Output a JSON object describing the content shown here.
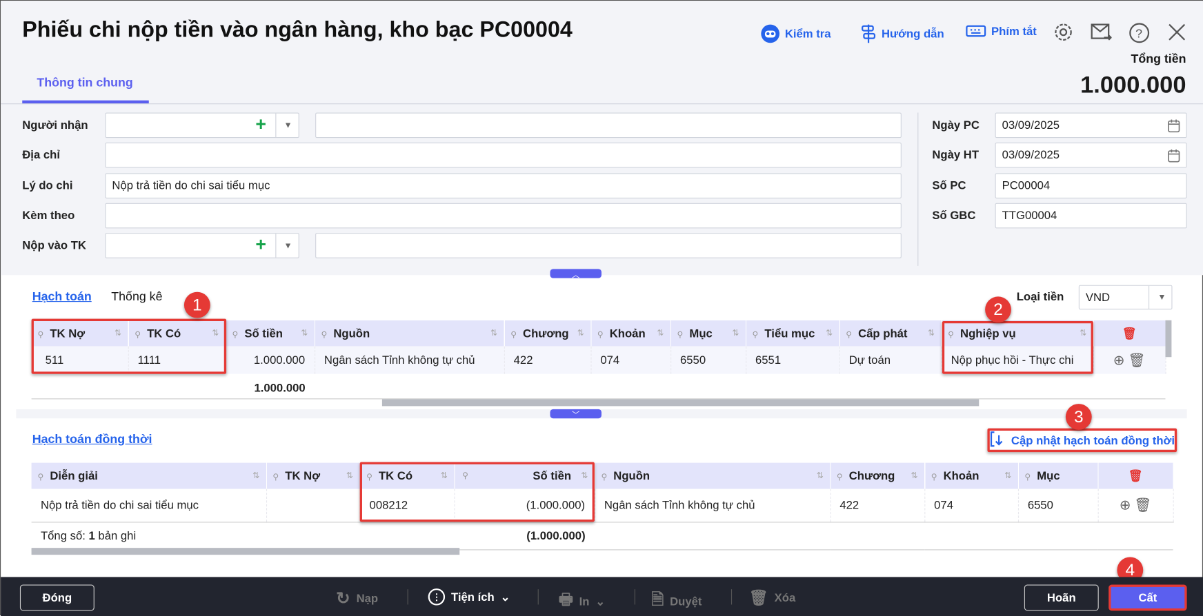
{
  "header": {
    "title": "Phiếu chi nộp tiền vào ngân hàng, kho bạc PC00004",
    "tools": {
      "check": "Kiểm tra",
      "guide": "Hướng dẫn",
      "shortcut": "Phím tắt"
    },
    "total_label": "Tổng tiền",
    "total_value": "1.000.000",
    "tab": "Thông tin chung"
  },
  "form": {
    "recipient_label": "Người nhận",
    "recipient_value": "",
    "recipient_name": "",
    "address_label": "Địa chỉ",
    "address_value": "",
    "reason_label": "Lý do chi",
    "reason_value": "Nộp trả tiền do chi sai tiểu mục",
    "attach_label": "Kèm theo",
    "attach_value": "",
    "account_label": "Nộp vào TK",
    "account_value": "",
    "account_name": "",
    "date_pc_label": "Ngày PC",
    "date_pc": "03/09/2025",
    "date_ht_label": "Ngày HT",
    "date_ht": "03/09/2025",
    "so_pc_label": "Số PC",
    "so_pc": "PC00004",
    "so_gbc_label": "Số GBC",
    "so_gbc": "TTG00004"
  },
  "section1": {
    "tabs": [
      "Hạch toán",
      "Thống kê"
    ],
    "currency_label": "Loại tiền",
    "currency": "VND",
    "columns": [
      "TK Nợ",
      "TK Có",
      "Số tiền",
      "Nguồn",
      "Chương",
      "Khoản",
      "Mục",
      "Tiểu mục",
      "Cấp phát",
      "Nghiệp vụ"
    ],
    "rows": [
      [
        "511",
        "1111",
        "1.000.000",
        "Ngân sách Tỉnh không tự chủ",
        "422",
        "074",
        "6550",
        "6551",
        "Dự toán",
        "Nộp phục hồi - Thực chi"
      ]
    ],
    "total": "1.000.000"
  },
  "section2": {
    "title": "Hạch toán đồng thời",
    "update_button": "Cập nhật hạch toán đồng thời",
    "columns": [
      "Diễn giải",
      "TK Nợ",
      "TK Có",
      "Số tiền",
      "Nguồn",
      "Chương",
      "Khoản",
      "Mục"
    ],
    "rows": [
      [
        "Nộp trả tiền do chi sai tiểu mục",
        "",
        "008212",
        "(1.000.000)",
        "Ngân sách Tỉnh không tự chủ",
        "422",
        "074",
        "6550"
      ]
    ],
    "footer_prefix": "Tổng số: ",
    "footer_count": "1",
    "footer_suffix": " bản ghi",
    "total": "(1.000.000)"
  },
  "badges": [
    "1",
    "2",
    "3",
    "4"
  ],
  "footer": {
    "close": "Đóng",
    "reload": "Nạp",
    "utilities": "Tiện ích",
    "print": "In",
    "approve": "Duyệt",
    "delete": "Xóa",
    "cancel": "Hoãn",
    "save": "Cất"
  },
  "colors": {
    "accent": "#5b5fef",
    "link": "#2563eb",
    "highlight": "#e53935",
    "footer_bg": "#22252f"
  }
}
